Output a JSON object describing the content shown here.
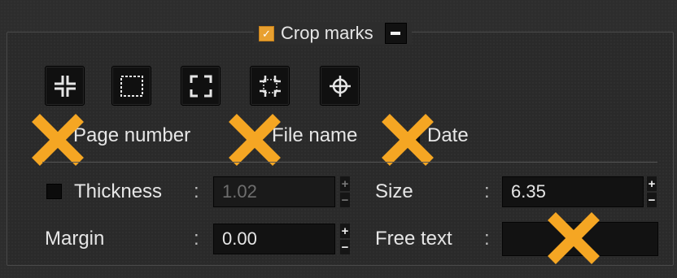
{
  "group": {
    "title": "Crop marks",
    "enabled": true,
    "collapse_label": "−"
  },
  "toolbar": {
    "buttons": [
      {
        "icon": "crop-marks-inner-icon"
      },
      {
        "icon": "dashed-rectangle-icon"
      },
      {
        "icon": "crop-marks-outer-icon"
      },
      {
        "icon": "crop-marks-frame-icon"
      },
      {
        "icon": "registration-target-icon"
      }
    ]
  },
  "options": {
    "page_number": "Page number",
    "file_name": "File name",
    "date": "Date"
  },
  "fields": {
    "thickness": {
      "label": "Thickness",
      "value": "1.02",
      "enabled": false
    },
    "size": {
      "label": "Size",
      "value": "6.35"
    },
    "margin": {
      "label": "Margin",
      "value": "0.00"
    },
    "free_text": {
      "label": "Free text",
      "value": ""
    },
    "colon": ":"
  },
  "spin": {
    "up": "+",
    "down": "−"
  },
  "overlay": {
    "mark_color": "#f5a623"
  }
}
